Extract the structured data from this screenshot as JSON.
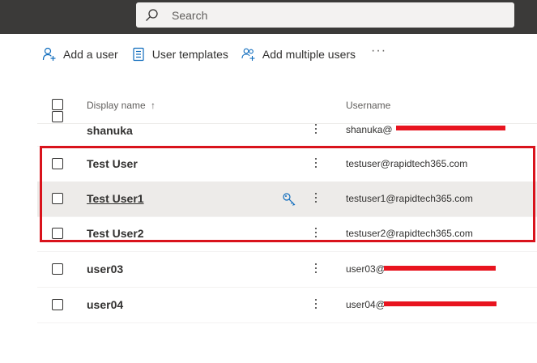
{
  "search": {
    "placeholder": "Search"
  },
  "toolbar": {
    "add_user": "Add a user",
    "user_templates": "User templates",
    "add_multiple": "Add multiple users",
    "more": "···"
  },
  "table": {
    "headers": {
      "display_name": "Display name",
      "sort_arrow": "↑",
      "username": "Username"
    },
    "rows": [
      {
        "name": "shanuka",
        "email": "shanuka@"
      },
      {
        "name": "Test User",
        "email": "testuser@rapidtech365.com"
      },
      {
        "name": "Test User1",
        "email": "testuser1@rapidtech365.com"
      },
      {
        "name": "Test User2",
        "email": "testuser2@rapidtech365.com"
      },
      {
        "name": "user03",
        "email": "user03@"
      },
      {
        "name": "user04",
        "email": "user04@"
      }
    ]
  },
  "colors": {
    "highlight": "#d9131c",
    "redaction": "#e8141f",
    "topbar": "#3b3a39",
    "accent": "#0f6cbd"
  }
}
